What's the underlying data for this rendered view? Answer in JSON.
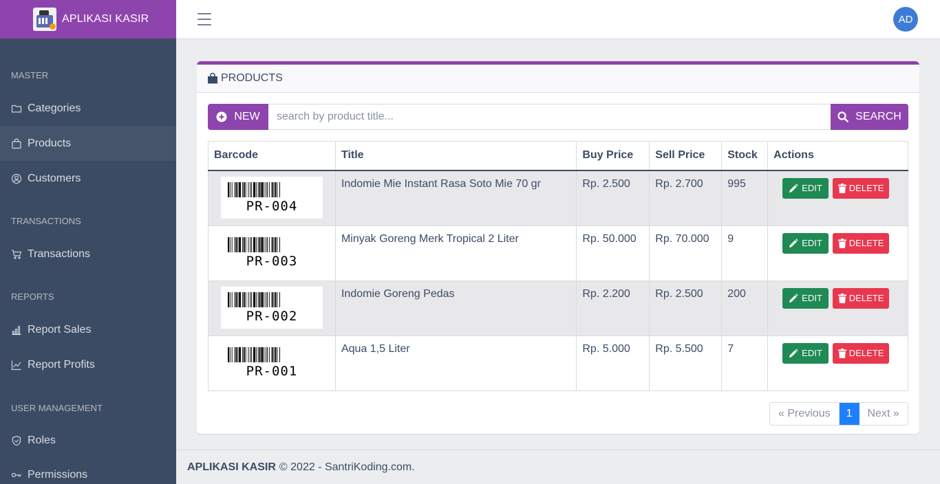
{
  "brand": {
    "name": "APLIKASI KASIR",
    "color": "#8e44ad"
  },
  "sidebar": {
    "sections": [
      {
        "title": "MASTER",
        "items": [
          {
            "label": "Categories",
            "icon": "folder-icon"
          },
          {
            "label": "Products",
            "icon": "shopping-bag-icon",
            "active": true
          },
          {
            "label": "Customers",
            "icon": "user-circle-icon"
          }
        ]
      },
      {
        "title": "TRANSACTIONS",
        "items": [
          {
            "label": "Transactions",
            "icon": "cart-icon"
          }
        ]
      },
      {
        "title": "REPORTS",
        "items": [
          {
            "label": "Report Sales",
            "icon": "bar-chart-icon"
          },
          {
            "label": "Report Profits",
            "icon": "line-chart-icon"
          }
        ]
      },
      {
        "title": "USER MANAGEMENT",
        "items": [
          {
            "label": "Roles",
            "icon": "shield-icon"
          },
          {
            "label": "Permissions",
            "icon": "key-icon"
          }
        ]
      }
    ]
  },
  "header": {
    "avatar_initials": "AD"
  },
  "card": {
    "title": "PRODUCTS",
    "new_label": "NEW",
    "search_placeholder": "search by product title...",
    "search_label": "SEARCH"
  },
  "table": {
    "columns": [
      "Barcode",
      "Title",
      "Buy Price",
      "Sell Price",
      "Stock",
      "Actions"
    ],
    "rows": [
      {
        "barcode": "PR-004",
        "title": "Indomie Mie Instant Rasa Soto Mie 70 gr",
        "buy_price": "Rp. 2.500",
        "sell_price": "Rp. 2.700",
        "stock": "995"
      },
      {
        "barcode": "PR-003",
        "title": "Minyak Goreng Merk Tropical 2 Liter",
        "buy_price": "Rp. 50.000",
        "sell_price": "Rp. 70.000",
        "stock": "9"
      },
      {
        "barcode": "PR-002",
        "title": "Indomie Goreng Pedas",
        "buy_price": "Rp. 2.200",
        "sell_price": "Rp. 2.500",
        "stock": "200"
      },
      {
        "barcode": "PR-001",
        "title": "Aqua 1,5 Liter",
        "buy_price": "Rp. 5.000",
        "sell_price": "Rp. 5.500",
        "stock": "7"
      }
    ],
    "edit_label": "EDIT",
    "delete_label": "DELETE"
  },
  "pagination": {
    "prev": "« Previous",
    "current": "1",
    "next": "Next »"
  },
  "footer": {
    "brand": "APLIKASI KASIR",
    "text": "© 2022 - SantriKoding.com."
  },
  "colors": {
    "sidebar": "#3c4b64",
    "primary": "#8e44ad",
    "edit": "#1f8a54",
    "delete": "#e8384f",
    "page_active": "#1e80ff"
  }
}
